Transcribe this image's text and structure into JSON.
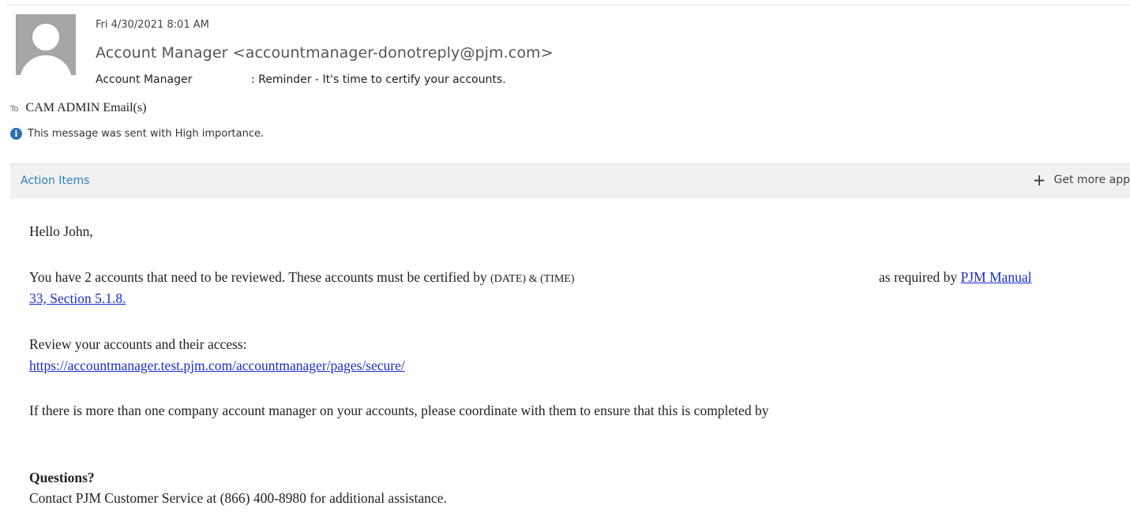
{
  "header": {
    "date": "Fri 4/30/2021 8:01 AM",
    "from": "Account Manager <accountmanager-donotreply@pjm.com>",
    "subject_from": "Account Manager",
    "subject": ": Reminder - It's time to certify your accounts.",
    "to_label": "To",
    "to_value": "CAM ADMIN Email(s)",
    "importance_note": "This message was sent with High importance."
  },
  "action_bar": {
    "action_items_label": "Action Items",
    "get_more_label": "Get more app"
  },
  "body": {
    "greeting": "Hello John,",
    "para1_text": "You have 2 accounts that need to be reviewed. These accounts must be certified by",
    "para1_date_time": "(DATE) & (TIME)",
    "para1_required": "as required by",
    "para1_link_part1": "PJM Manual",
    "para1_link_part2": "33, Section 5.1.8.",
    "para2_text": "Review your accounts and their access:",
    "para2_link": "https://accountmanager.test.pjm.com/accountmanager/pages/secure/",
    "para3_text": "If there is more than one company account manager on your accounts, please coordinate with them to ensure that this is completed by",
    "questions_heading": "Questions?",
    "contact_text": "Contact PJM Customer Service at (866) 400-8980 for additional assistance."
  },
  "colors": {
    "accent": "#2c7fbe",
    "link": "#1a2dcc",
    "info_icon": "#2a6fb0"
  },
  "icons": {
    "avatar": "person-avatar-icon",
    "info": "info-icon",
    "plus": "plus-icon"
  }
}
